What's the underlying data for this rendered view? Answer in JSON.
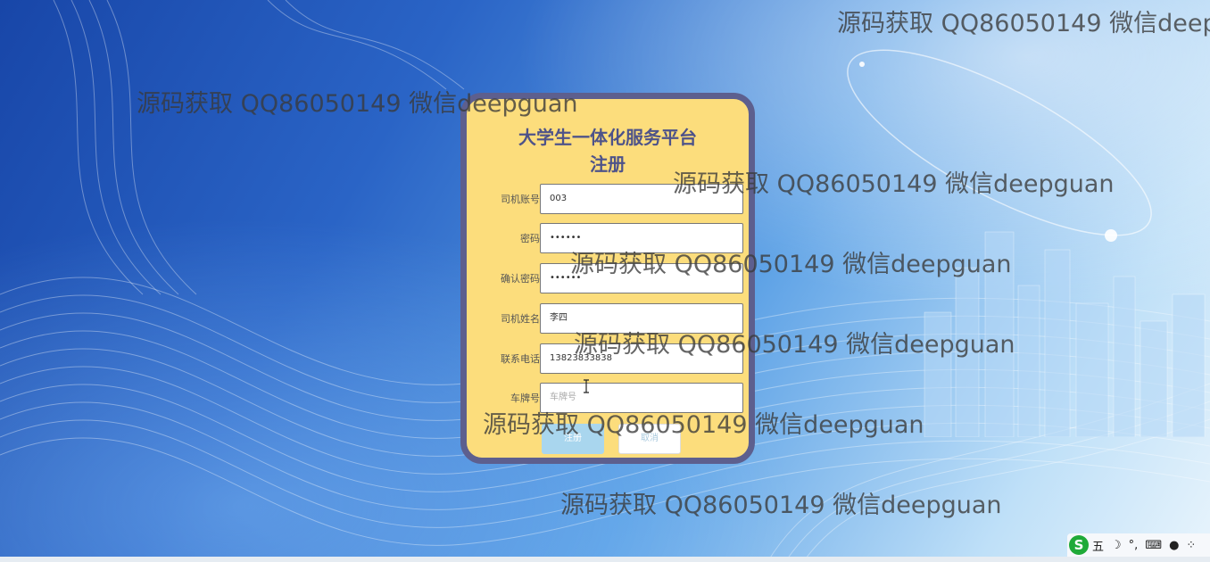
{
  "form": {
    "title_line1": "大学生一体化服务平台",
    "title_line2": "注册",
    "fields": [
      {
        "label": "司机账号",
        "value": "003",
        "placeholder": ""
      },
      {
        "label": "密码",
        "value": "••••••",
        "placeholder": ""
      },
      {
        "label": "确认密码",
        "value": "••••••",
        "placeholder": ""
      },
      {
        "label": "司机姓名",
        "value": "李四",
        "placeholder": ""
      },
      {
        "label": "联系电话",
        "value": "13823833838",
        "placeholder": ""
      },
      {
        "label": "车牌号",
        "value": "",
        "placeholder": "车牌号"
      }
    ],
    "submit_label": "注册",
    "cancel_label": "取消"
  },
  "watermark_text": "源码获取 QQ86050149 微信deepguan",
  "ime": {
    "logo": "S",
    "mode": "五",
    "icons": [
      "moon-icon",
      "punctuation-icon",
      "keyboard-icon",
      "user-icon",
      "menu-grid-icon"
    ]
  },
  "colors": {
    "card_bg": "#fcdd7c",
    "card_border": "#5d5f8e",
    "title": "#4e5389",
    "submit_bg": "#a9d6ee"
  }
}
